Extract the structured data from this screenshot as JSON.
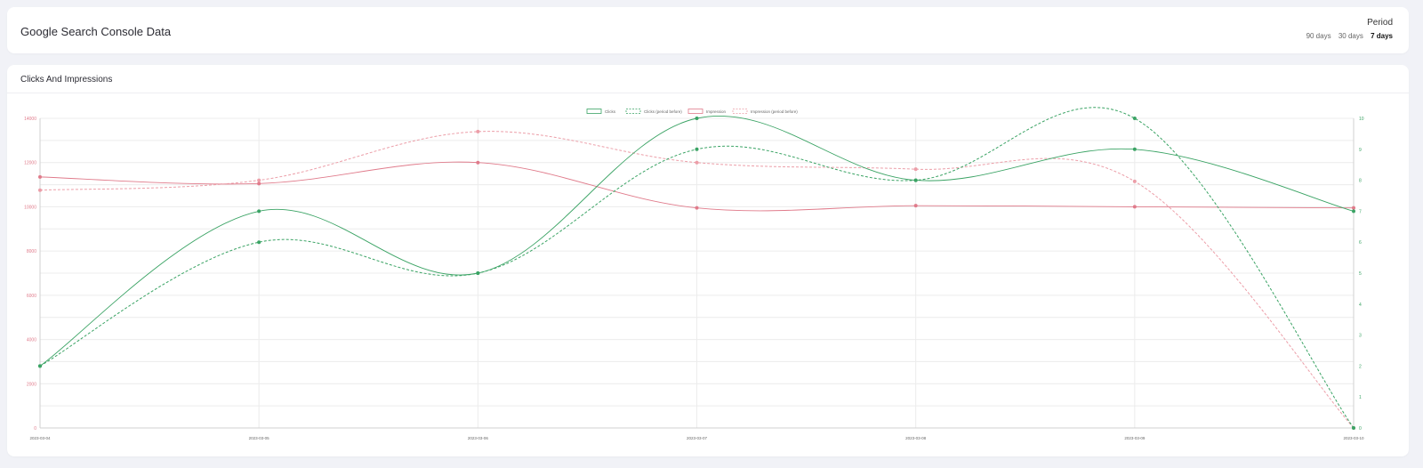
{
  "header": {
    "title": "Google Search Console Data",
    "period_label": "Period",
    "period_options": [
      {
        "label": "90 days",
        "active": false
      },
      {
        "label": "30 days",
        "active": false
      },
      {
        "label": "7 days",
        "active": true
      }
    ]
  },
  "chart_card": {
    "title": "Clicks And Impressions"
  },
  "colors": {
    "clicks": "#3aa364",
    "impressions": "#e07b8b",
    "impressions_prev": "#ec9ea8"
  },
  "chart_data": {
    "type": "line",
    "title": "Clicks And Impressions",
    "x": [
      "2023-03-04",
      "2023-03-05",
      "2023-03-06",
      "2023-03-07",
      "2023-03-08",
      "2023-03-09",
      "2023-03-10"
    ],
    "y_left": {
      "range": [
        0,
        14000
      ],
      "ticks": [
        0,
        2000,
        4000,
        6000,
        8000,
        10000,
        12000,
        14000
      ]
    },
    "y_right": {
      "range": [
        0,
        10
      ],
      "ticks": [
        0,
        1,
        2,
        3,
        4,
        5,
        6,
        7,
        8,
        9,
        10
      ]
    },
    "grid": true,
    "legend_position": "top-center",
    "series": [
      {
        "name": "Clicks",
        "axis": "right",
        "dashed": false,
        "values": [
          2,
          7,
          5,
          10,
          8,
          9,
          7
        ]
      },
      {
        "name": "Clicks (period before)",
        "axis": "right",
        "dashed": true,
        "values": [
          2,
          6,
          5,
          9,
          8,
          10,
          0
        ]
      },
      {
        "name": "Impression",
        "axis": "left",
        "dashed": false,
        "values": [
          11350,
          11050,
          12000,
          9950,
          10050,
          10000,
          9950
        ]
      },
      {
        "name": "Impression (period before)",
        "axis": "left",
        "dashed": true,
        "values": [
          10750,
          11200,
          13400,
          12000,
          11700,
          11150,
          0
        ]
      }
    ]
  }
}
